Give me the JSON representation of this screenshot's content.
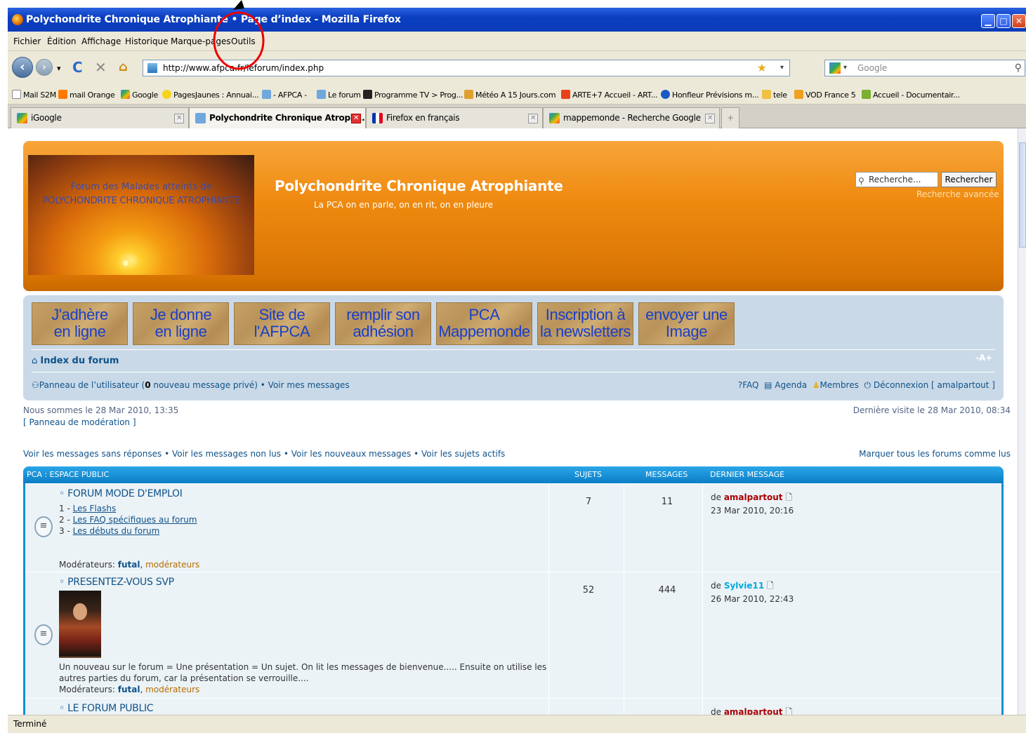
{
  "window": {
    "title": "Polychondrite Chronique Atrophiante • Page d’index - Mozilla Firefox"
  },
  "menu": [
    "Fichier",
    "Édition",
    "Affichage",
    "Historique",
    "Marque-pages",
    "Outils"
  ],
  "address": {
    "url": "http://www.afpca.fr/leforum/index.php",
    "search_placeholder": "Google"
  },
  "bookmarks": [
    {
      "label": "Mail S2M",
      "icon": "page-icon",
      "color": "#ffffff"
    },
    {
      "label": "mail Orange",
      "icon": "orange-icon",
      "color": "#ff7900"
    },
    {
      "label": "Google",
      "icon": "google-icon",
      "color": "#4285f4"
    },
    {
      "label": "PagesJaunes : Annuai...",
      "icon": "pagesjaunes-icon",
      "color": "#f6d31c"
    },
    {
      "label": "- AFPCA -",
      "icon": "afpca-icon",
      "color": "#6fa8dc"
    },
    {
      "label": "Le forum",
      "icon": "afpca-icon",
      "color": "#6fa8dc"
    },
    {
      "label": "Programme TV > Prog...",
      "icon": "tv-icon",
      "color": "#222222"
    },
    {
      "label": "Météo A 15 Jours.com",
      "icon": "weather-icon",
      "color": "#e0a030"
    },
    {
      "label": "ARTE+7 Accueil - ART...",
      "icon": "arte-icon",
      "color": "#e8421a"
    },
    {
      "label": "Honfleur Prévisions m...",
      "icon": "honfleur-icon",
      "color": "#1a5ac8"
    },
    {
      "label": "tele",
      "icon": "folder-icon",
      "color": "#f0c040"
    },
    {
      "label": "VOD France 5",
      "icon": "rss-icon",
      "color": "#f0a020"
    },
    {
      "label": "Accueil - Documentair...",
      "icon": "doc-icon",
      "color": "#7ab030"
    }
  ],
  "tabs": [
    {
      "label": "iGoogle",
      "active": false
    },
    {
      "label": "Polychondrite Chronique Atrophi...",
      "active": true
    },
    {
      "label": "Firefox en français",
      "active": false
    },
    {
      "label": "mappemonde - Recherche Google",
      "active": false
    }
  ],
  "status": "Terminé",
  "site": {
    "logo_line1": "Forum des Malades atteints de",
    "logo_line2": "POLYCHONDRITE CHRONIQUE ATROPHIANTE",
    "title": "Polychondrite Chronique Atrophiante",
    "description": "La PCA on en parle, on en rit, on en pleure",
    "search_placeholder": "Recherche...",
    "search_button": "Rechercher",
    "advanced_search": "Recherche avancée"
  },
  "nav_buttons": [
    {
      "l1": "J'adhère",
      "l2": "en ligne"
    },
    {
      "l1": "Je donne",
      "l2": "en ligne"
    },
    {
      "l1": "Site de",
      "l2": "l'AFPCA"
    },
    {
      "l1": "remplir son",
      "l2": "adhésion"
    },
    {
      "l1": "PCA",
      "l2": "Mappemonde"
    },
    {
      "l1": "Inscription à",
      "l2": "la newsletters"
    },
    {
      "l1": "envoyer une",
      "l2": "Image"
    }
  ],
  "breadcrumb": {
    "index": "Index du forum",
    "font_size": "-A+"
  },
  "user_bar": {
    "ucp_prefix": "Panneau de l’utilisateur (",
    "pm_count": "0",
    "ucp_suffix": " nouveau message privé) • Voir mes messages",
    "faq": "FAQ",
    "agenda": "Agenda",
    "members": "Membres",
    "logout": "Déconnexion [ amalpartout ]"
  },
  "info": {
    "now": "Nous sommes le 28 Mar 2010, 13:35",
    "mcp": "[ Panneau de modération ]",
    "last_visit": "Dernière visite le 28 Mar 2010, 08:34",
    "search_links": "Voir les messages sans réponses • Voir les messages non lus • Voir les nouveaux messages • Voir les sujets actifs",
    "mark_read": "Marquer tous les forums comme lus"
  },
  "forum": {
    "category": "PCA : ESPACE PUBLIC",
    "col_topics": "SUJETS",
    "col_posts": "MESSAGES",
    "col_last": "DERNIER MESSAGE",
    "rows": [
      {
        "title": "FORUM MODE D'EMPLOI",
        "subs": [
          {
            "n": "1 - ",
            "t": "Les Flashs"
          },
          {
            "n": "2 - ",
            "t": "Les FAQ spécifiques au forum"
          },
          {
            "n": "3 - ",
            "t": "Les débuts du forum"
          }
        ],
        "topics": "7",
        "posts": "11",
        "last_by": "amalpartout",
        "last_by_color": "#aa0000",
        "last_date": "23 Mar 2010, 20:16",
        "moderators_label": "Modérateurs:",
        "mod1": "futal",
        "mod2": "modérateurs"
      },
      {
        "title": "PRESENTEZ-VOUS SVP",
        "desc1": "Un nouveau sur le forum = Une présentation = Un sujet. On lit les messages de bienvenue..... Ensuite on utilise les",
        "desc2": "autres parties du forum, car la présentation se verrouille....",
        "topics": "52",
        "posts": "444",
        "last_by": "Sylvie11",
        "last_by_color": "#00aadd",
        "last_date": "26 Mar 2010, 22:43",
        "moderators_label": "Modérateurs:",
        "mod1": "futal",
        "mod2": "modérateurs"
      },
      {
        "title": "LE FORUM PUBLIC",
        "last_by": "amalpartout",
        "last_by_color": "#aa0000"
      }
    ]
  }
}
